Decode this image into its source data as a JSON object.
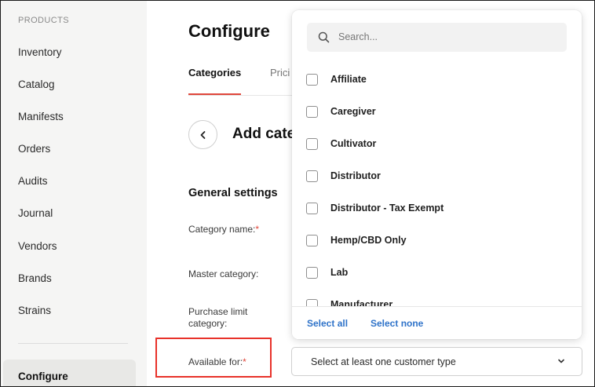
{
  "sidebar": {
    "heading": "PRODUCTS",
    "items": [
      "Inventory",
      "Catalog",
      "Manifests",
      "Orders",
      "Audits",
      "Journal",
      "Vendors",
      "Brands",
      "Strains"
    ],
    "active": "Configure"
  },
  "page": {
    "title": "Configure",
    "tabs": [
      "Categories",
      "Prici"
    ],
    "section_title": "Add cate",
    "group_title": "General settings",
    "labels": {
      "category_name": "Category name:",
      "master_category": "Master category:",
      "purchase_limit_1": "Purchase limit",
      "purchase_limit_2": "category:",
      "available_for": "Available for:"
    },
    "required_mark": "*",
    "customer_type_select": "Select at least one customer type"
  },
  "dropdown": {
    "search_placeholder": "Search...",
    "options": [
      "Affiliate",
      "Caregiver",
      "Cultivator",
      "Distributor",
      "Distributor - Tax Exempt",
      "Hemp/CBD Only",
      "Lab",
      "Manufacturer"
    ],
    "select_all": "Select all",
    "select_none": "Select none"
  },
  "colors": {
    "accent": "#e0463a",
    "link": "#2f73c9",
    "highlight": "#e8322a"
  }
}
